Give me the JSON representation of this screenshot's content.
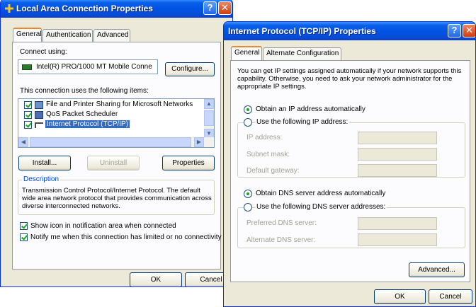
{
  "lan_window": {
    "title": "Local Area Connection Properties",
    "tabs": [
      "General",
      "Authentication",
      "Advanced"
    ],
    "connect_using_label": "Connect using:",
    "adapter_name": "Intel(R) PRO/1000 MT Mobile Conne",
    "configure_button": "Configure...",
    "items_label": "This connection uses the following items:",
    "items": [
      {
        "label": "File and Printer Sharing for Microsoft Networks",
        "checked": true,
        "icon": "printer-icon"
      },
      {
        "label": "QoS Packet Scheduler",
        "checked": true,
        "icon": "scheduler-icon"
      },
      {
        "label": "Internet Protocol (TCP/IP)",
        "checked": true,
        "icon": "protocol-icon",
        "selected": true
      }
    ],
    "install_button": "Install...",
    "uninstall_button": "Uninstall",
    "properties_button": "Properties",
    "description_label": "Description",
    "description_text": "Transmission Control Protocol/Internet Protocol. The default wide area network protocol that provides communication across diverse interconnected networks.",
    "show_icon_label": "Show icon in notification area when connected",
    "notify_label": "Notify me when this connection has limited or no connectivity",
    "ok_button": "OK",
    "cancel_button": "Cancel"
  },
  "tcp_window": {
    "title": "Internet Protocol (TCP/IP) Properties",
    "tabs": [
      "General",
      "Alternate Configuration"
    ],
    "intro_text": "You can get IP settings assigned automatically if your network supports this capability. Otherwise, you need to ask your network administrator for the appropriate IP settings.",
    "obtain_ip_auto": "Obtain an IP address automatically",
    "use_following_ip": "Use the following IP address:",
    "ip_address_label": "IP address:",
    "subnet_mask_label": "Subnet mask:",
    "default_gateway_label": "Default gateway:",
    "obtain_dns_auto": "Obtain DNS server address automatically",
    "use_following_dns": "Use the following DNS server addresses:",
    "preferred_dns_label": "Preferred DNS server:",
    "alternate_dns_label": "Alternate DNS server:",
    "advanced_button": "Advanced...",
    "ok_button": "OK",
    "cancel_button": "Cancel"
  },
  "colors": {
    "title_bar": "#0054e3",
    "dialog_bg": "#ece9d8",
    "selection": "#316ac5",
    "check_green": "#21a121"
  }
}
